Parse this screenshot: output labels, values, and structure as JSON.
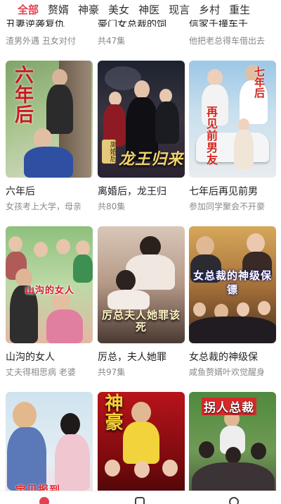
{
  "tabs": [
    "全部",
    "赘婿",
    "神豪",
    "美女",
    "神医",
    "现言",
    "乡村",
    "重生"
  ],
  "cut_row": [
    {
      "title": "丑妻逆袭复仇",
      "subtitle": "渣男外遇 丑女对付"
    },
    {
      "title": "豪门女总裁的饲",
      "subtitle": "共47集"
    },
    {
      "title": "信家千撞车千",
      "subtitle": "他把老总得车借出去"
    }
  ],
  "cards": [
    {
      "title": "六年后",
      "subtitle": "女孩考上大学，母亲",
      "poster_text": "六年后"
    },
    {
      "title": "离婚后，龙王归",
      "subtitle": "共80集",
      "poster_text": "龙王归来",
      "poster_badge": "离婚后"
    },
    {
      "title": "七年后再见前男",
      "subtitle": "参加同学聚会不开豪",
      "poster_text": "再见前男友",
      "poster_badge": "七年后"
    },
    {
      "title": "山沟的女人",
      "subtitle": "丈夫得相思病 老婆",
      "poster_text": "山沟的女人"
    },
    {
      "title": "厉总，夫人她罪",
      "subtitle": "共97集",
      "poster_text": "厉总夫人她罪该死"
    },
    {
      "title": "女总裁的神级保",
      "subtitle": "咸鱼赘婿叶欢觉醒身",
      "poster_text": "女总裁的神级保镖"
    },
    {
      "title": "",
      "subtitle": "",
      "poster_text": "宝贝报到"
    },
    {
      "title": "",
      "subtitle": "",
      "poster_text": "神豪"
    },
    {
      "title": "",
      "subtitle": "",
      "poster_text": "拐人总裁"
    }
  ],
  "colors": {
    "accent": "#e2414f",
    "title": "#222222",
    "subtitle": "#8a8a8a"
  },
  "nav_icons": [
    "home-icon",
    "discover-icon",
    "profile-icon"
  ]
}
